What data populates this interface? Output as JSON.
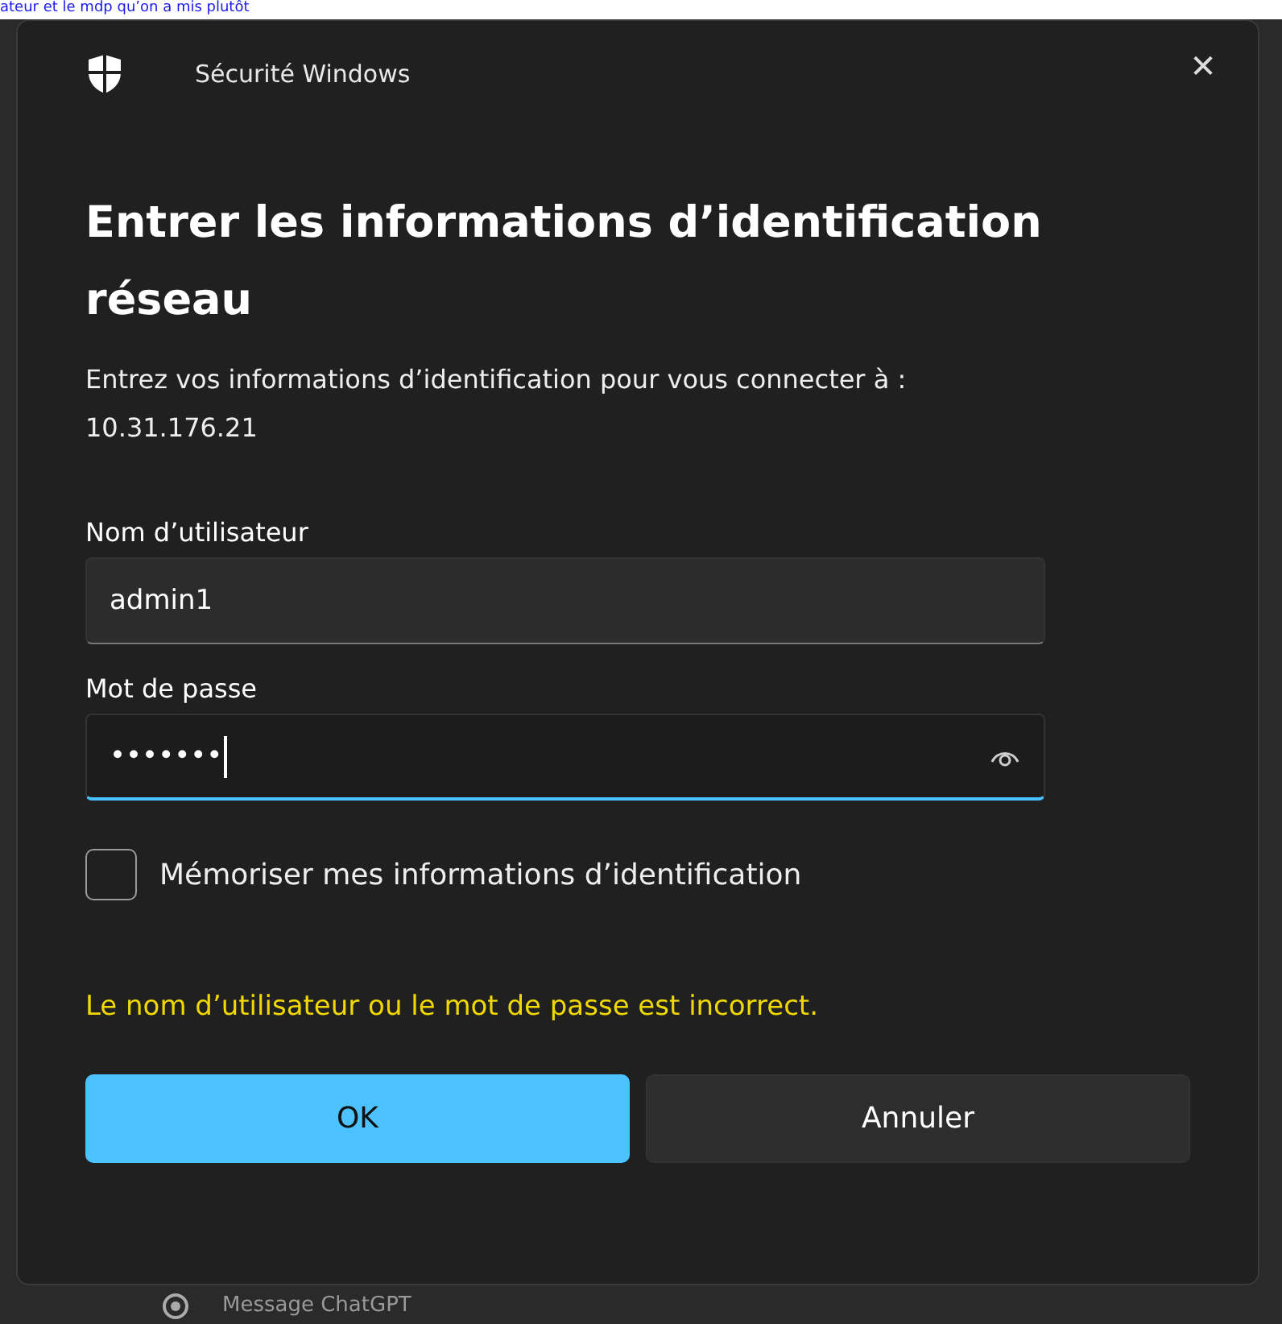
{
  "background": {
    "link_text": "ateur et le mdp qu’on a mis plutôt",
    "bottom_item": "Message ChatGPT"
  },
  "dialog": {
    "app_name": "Sécurité Windows",
    "close": "✕",
    "title": "Entrer les informations d’identification réseau",
    "message": "Entrez vos informations d’identification pour vous connecter à :",
    "host": "10.31.176.21",
    "fields": [
      {
        "kind": "text",
        "label": "Nom d’utilisateur",
        "value": "admin1",
        "focused": false
      },
      {
        "kind": "password",
        "label": "Mot de passe",
        "value": "•••••••",
        "focused": true
      }
    ],
    "remember": {
      "label": "Mémoriser mes informations d’identification",
      "checked": false
    },
    "error": "Le nom d’utilisateur ou le mot de passe est incorrect.",
    "buttons": [
      {
        "label": "OK",
        "primary": true
      },
      {
        "label": "Annuler",
        "primary": false
      }
    ]
  }
}
